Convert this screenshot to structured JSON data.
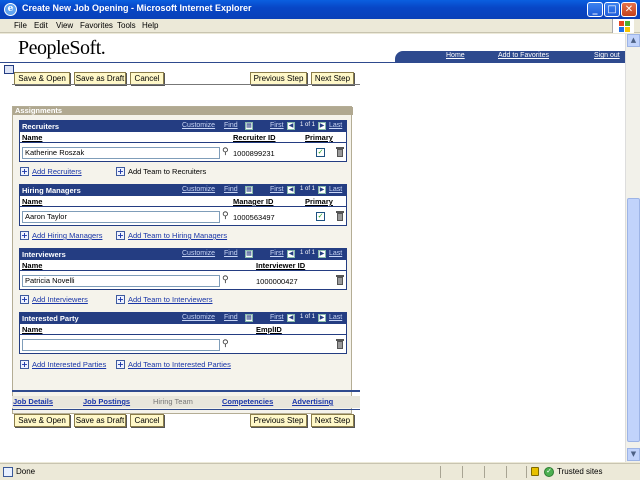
{
  "window": {
    "title": "Create New Job Opening - Microsoft Internet Explorer",
    "minimize": "_",
    "maximize": "□",
    "close": "✕"
  },
  "menu": [
    "File",
    "Edit",
    "View",
    "Favorites",
    "Tools",
    "Help"
  ],
  "header": {
    "logo": "PeopleSoft.",
    "links": [
      "Home",
      "Add to Favorites",
      "Sign out"
    ]
  },
  "buttons": {
    "save_open": "Save & Open",
    "save_draft": "Save as Draft",
    "cancel": "Cancel",
    "previous": "Previous Step",
    "next": "Next Step"
  },
  "assignments": {
    "title": "Assignments",
    "grid_nav": {
      "customize": "Customize",
      "find": "Find",
      "first": "First",
      "count": "1 of 1",
      "last": "Last"
    },
    "recruiters": {
      "title": "Recruiters",
      "col_name": "Name",
      "col_id": "Recruiter ID",
      "col_primary": "Primary",
      "name": "Katherine Roszak",
      "id": "1000899231",
      "add_link": "Add Recruiters",
      "add_team": "Add Team to Recruiters"
    },
    "hiring_managers": {
      "title": "Hiring Managers",
      "col_name": "Name",
      "col_id": "Manager ID",
      "col_primary": "Primary",
      "name": "Aaron Taylor",
      "id": "1000563497",
      "add_link": "Add Hiring Managers",
      "add_team": "Add Team to Hiring Managers"
    },
    "interviewers": {
      "title": "Interviewers",
      "col_name": "Name",
      "col_id": "Interviewer ID",
      "name": "Patricia Novelli",
      "id": "1000000427",
      "add_link": "Add Interviewers",
      "add_team": "Add Team to Interviewers"
    },
    "interested_party": {
      "title": "Interested Party",
      "col_name": "Name",
      "col_id": "EmplID",
      "name": "",
      "id": "",
      "add_link": "Add Interested Parties",
      "add_team": "Add Team to Interested Parties"
    }
  },
  "tabs": [
    "Job Details",
    "Job Postings",
    "Hiring Team",
    "Competencies",
    "Advertising"
  ],
  "status": {
    "text": "Done",
    "zone": "Trusted sites"
  },
  "colors": {
    "grid_header": "#243D82",
    "button_bg": "#FFF8C8",
    "link": "#1A36A8"
  }
}
